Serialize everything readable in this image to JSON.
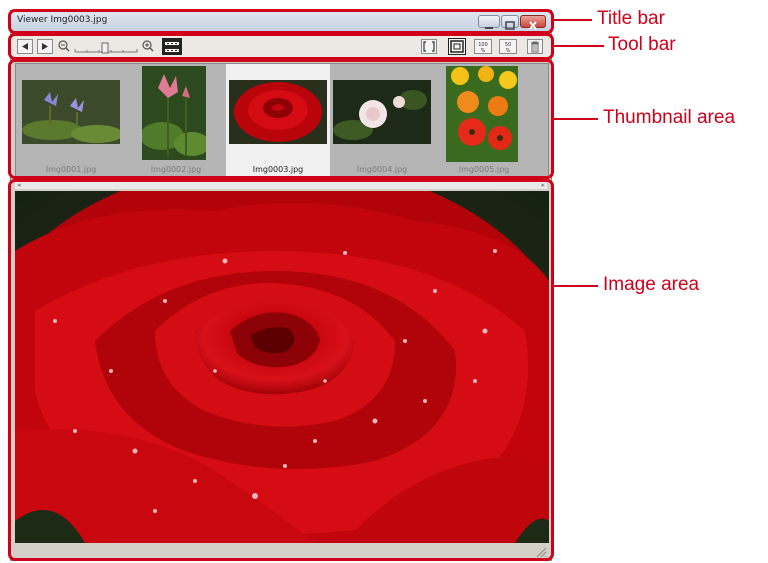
{
  "window": {
    "title": "Viewer Img0003.jpg",
    "buttons": [
      "minimize-icon",
      "maximize-icon",
      "close-icon"
    ]
  },
  "toolbar": {
    "left_icons": [
      "previous-icon",
      "next-icon",
      "zoom-out-icon",
      "zoom-slider",
      "zoom-in-icon",
      "filmstrip-icon"
    ],
    "right_icons": [
      "fit-screen-icon",
      "fit-window-icon",
      "actual-size-100-icon",
      "half-size-50-icon",
      "trash-icon"
    ],
    "label_100": "100",
    "label_50": "50",
    "label_percent": "%"
  },
  "thumbnails": [
    {
      "label": "Img0001.jpg",
      "selected": false
    },
    {
      "label": "Img0002.jpg",
      "selected": false
    },
    {
      "label": "Img0003.jpg",
      "selected": true
    },
    {
      "label": "Img0004.jpg",
      "selected": false
    },
    {
      "label": "Img0005.jpg",
      "selected": false
    }
  ],
  "callouts": {
    "title_bar": "Title bar",
    "tool_bar": "Tool bar",
    "thumbnail_area": "Thumbnail area",
    "image_area": "Image area"
  },
  "colors": {
    "annotation": "#d0001a",
    "rose": "#c8050c"
  }
}
